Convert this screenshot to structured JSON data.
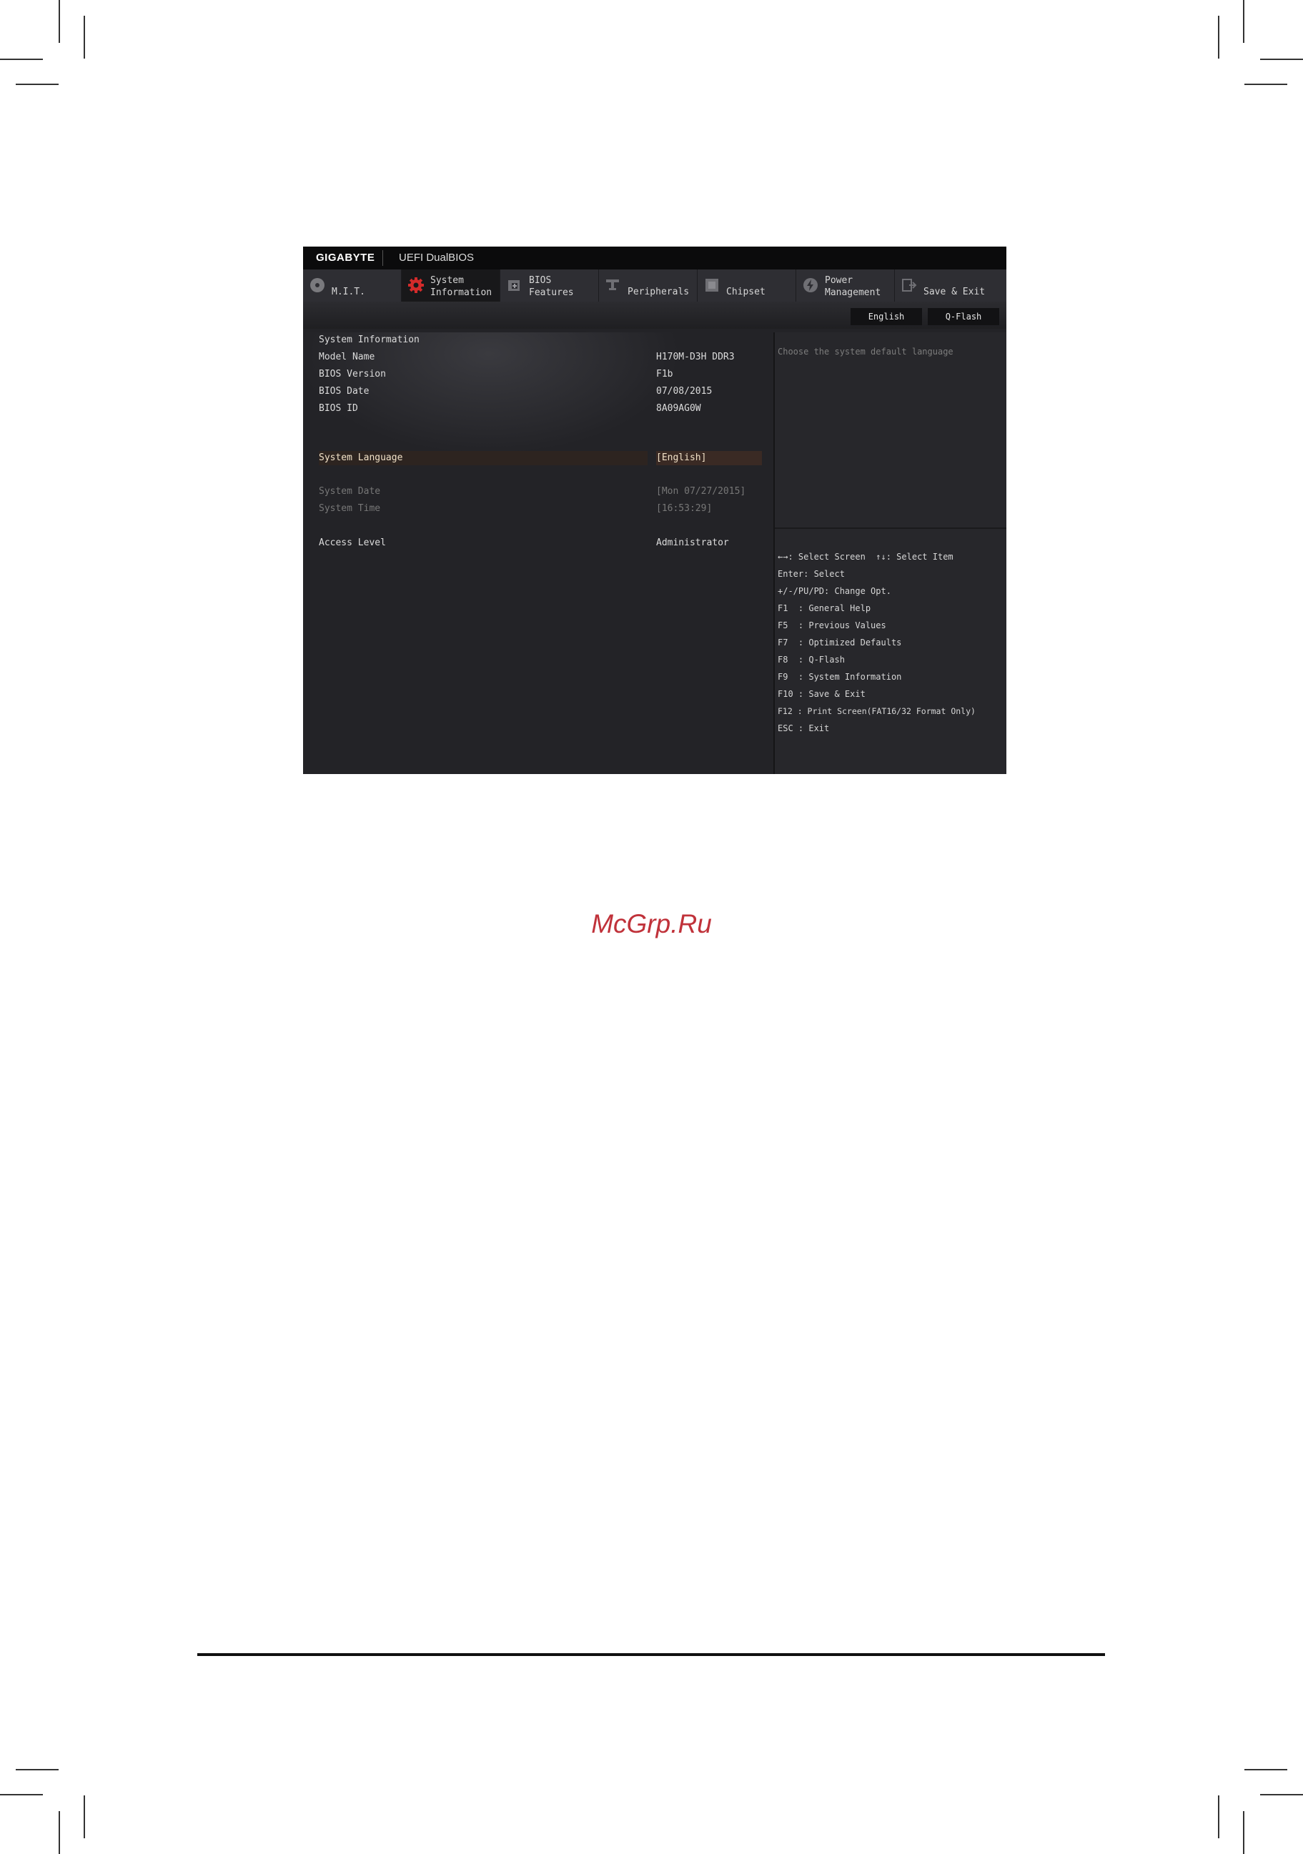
{
  "titlebar": {
    "brand": "GIGABYTE",
    "product": "UEFI DualBIOS"
  },
  "tabs": [
    {
      "line1": "",
      "line2": "M.I.T.",
      "icon": "disc-icon"
    },
    {
      "line1": "System",
      "line2": "Information",
      "icon": "gear-icon",
      "active": true
    },
    {
      "line1": "BIOS",
      "line2": "Features",
      "icon": "bios-chip-icon"
    },
    {
      "line1": "",
      "line2": "Peripherals",
      "icon": "peripheral-icon"
    },
    {
      "line1": "",
      "line2": "Chipset",
      "icon": "chipset-icon"
    },
    {
      "line1": "Power",
      "line2": "Management",
      "icon": "power-icon"
    },
    {
      "line1": "",
      "line2": "Save & Exit",
      "icon": "exit-icon"
    }
  ],
  "toolbar": {
    "language": "English",
    "qflash": "Q-Flash"
  },
  "info": {
    "section": "System Information",
    "model_label": "Model Name",
    "model_value": "H170M-D3H DDR3",
    "bios_version_label": "BIOS Version",
    "bios_version_value": "F1b",
    "bios_date_label": "BIOS Date",
    "bios_date_value": "07/08/2015",
    "bios_id_label": "BIOS ID",
    "bios_id_value": "8A09AG0W",
    "language_label": "System Language",
    "language_value": "[English]",
    "date_label": "System Date",
    "date_value": "[Mon 07/27/2015]",
    "time_label": "System Time",
    "time_value": "[16:53:29]",
    "access_label": "Access Level",
    "access_value": "Administrator"
  },
  "help": {
    "description": "Choose the system default language",
    "keys": [
      "←→: Select Screen  ↑↓: Select Item",
      "Enter: Select",
      "+/-/PU/PD: Change Opt.",
      "F1  : General Help",
      "F5  : Previous Values",
      "F7  : Optimized Defaults",
      "F8  : Q-Flash",
      "F9  : System Information",
      "F10 : Save & Exit",
      "F12 : Print Screen(FAT16/32 Format Only)",
      "ESC : Exit"
    ]
  },
  "watermark": "McGrp.Ru"
}
